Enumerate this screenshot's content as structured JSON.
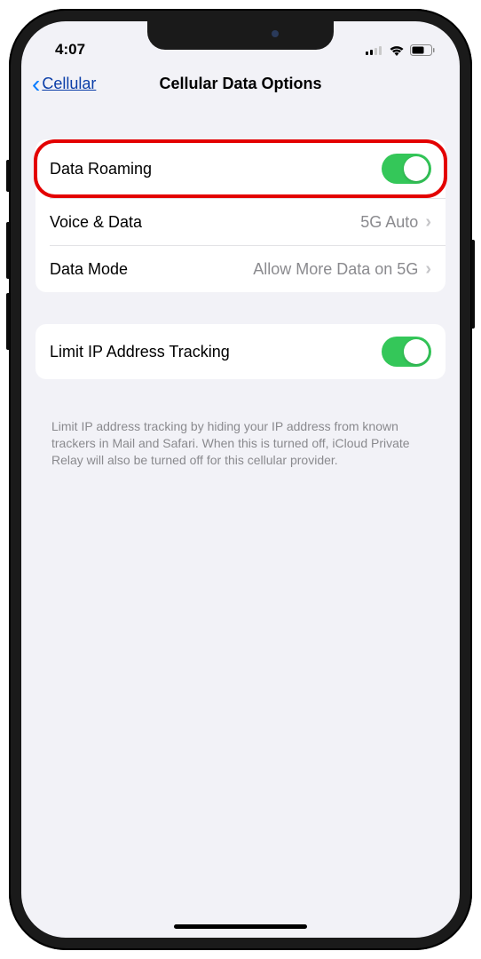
{
  "status": {
    "time": "4:07"
  },
  "nav": {
    "back_label": "Cellular",
    "title": "Cellular Data Options"
  },
  "group1": {
    "row1": {
      "label": "Data Roaming"
    },
    "row2": {
      "label": "Voice & Data",
      "value": "5G Auto"
    },
    "row3": {
      "label": "Data Mode",
      "value": "Allow More Data on 5G"
    }
  },
  "group2": {
    "row1": {
      "label": "Limit IP Address Tracking"
    },
    "footer": "Limit IP address tracking by hiding your IP address from known trackers in Mail and Safari. When this is turned off, iCloud Private Relay will also be turned off for this cellular provider."
  }
}
